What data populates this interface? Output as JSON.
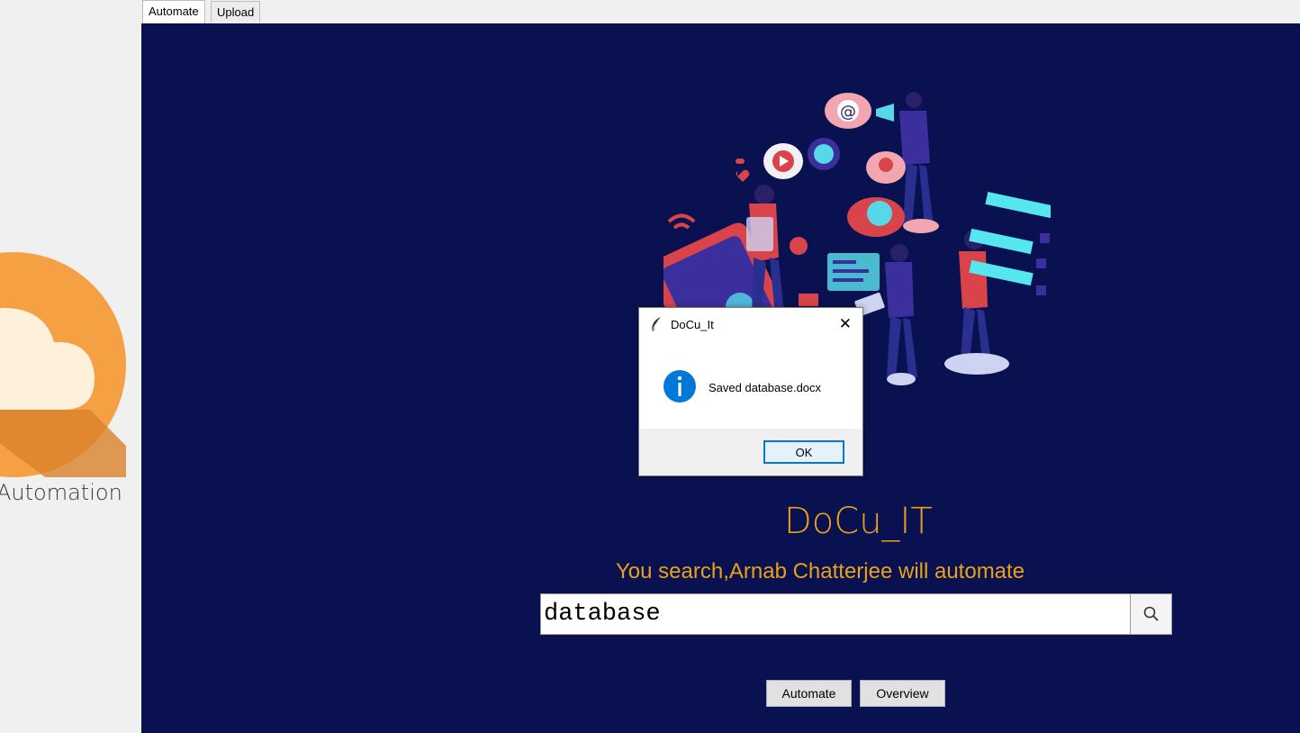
{
  "left_panel": {
    "label": "Automation",
    "logo_icon": "cloud-icon"
  },
  "tabs": [
    {
      "label": "Automate",
      "active": true
    },
    {
      "label": "Upload",
      "active": false
    }
  ],
  "main": {
    "brand_title": "DoCu_IT",
    "tagline": "You search,Arnab Chatterjee will automate",
    "search": {
      "value": "database",
      "icon": "search-icon"
    },
    "buttons": {
      "automate": "Automate",
      "overview": "Overview"
    }
  },
  "dialog": {
    "title": "DoCu_It",
    "message": "Saved database.docx",
    "ok_label": "OK",
    "icon": "info-icon",
    "close_glyph": "✕"
  },
  "colors": {
    "navy_background": "#0a1150",
    "brand_orange": "#e8a21a",
    "logo_orange": "#f5a042",
    "accent_blue": "#0078d7"
  }
}
